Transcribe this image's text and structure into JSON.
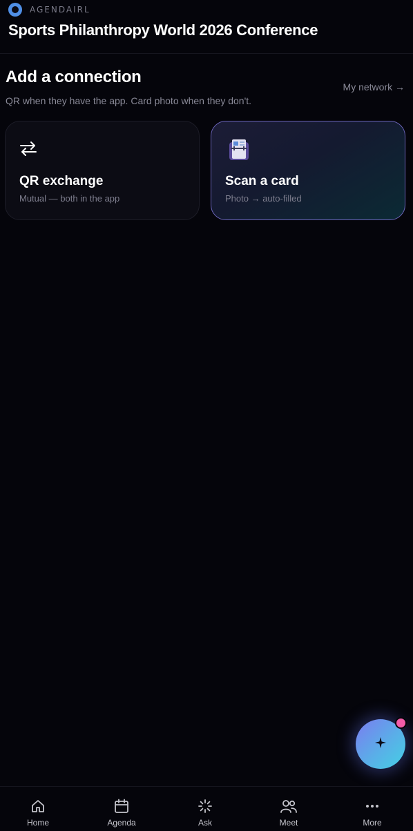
{
  "brand": {
    "name": "AGENDAIRL",
    "logo": "ring-logo-icon",
    "accent": "#4f8fe6"
  },
  "event": {
    "title": "Sports Philanthropy World 2026 Conference"
  },
  "connection": {
    "title": "Add a connection",
    "subtitle": "QR when they have the app. Card photo when they don't.",
    "network_link": "My network →"
  },
  "cards": [
    {
      "icon": "swap-arrows-icon",
      "title": "QR exchange",
      "subtitle": "Mutual — both in the app"
    },
    {
      "icon": "card-scanner-icon",
      "title": "Scan a card",
      "subtitle": "Photo → auto-filled",
      "highlighted": true
    }
  ],
  "fab": {
    "icon": "sparkle-icon",
    "badge_color": "#f25ca8"
  },
  "tabs": [
    {
      "label": "Home",
      "icon": "home-icon"
    },
    {
      "label": "Agenda",
      "icon": "calendar-icon"
    },
    {
      "label": "Ask",
      "icon": "spinner-icon"
    },
    {
      "label": "Meet",
      "icon": "people-icon"
    },
    {
      "label": "More",
      "icon": "more-dots-icon"
    }
  ]
}
